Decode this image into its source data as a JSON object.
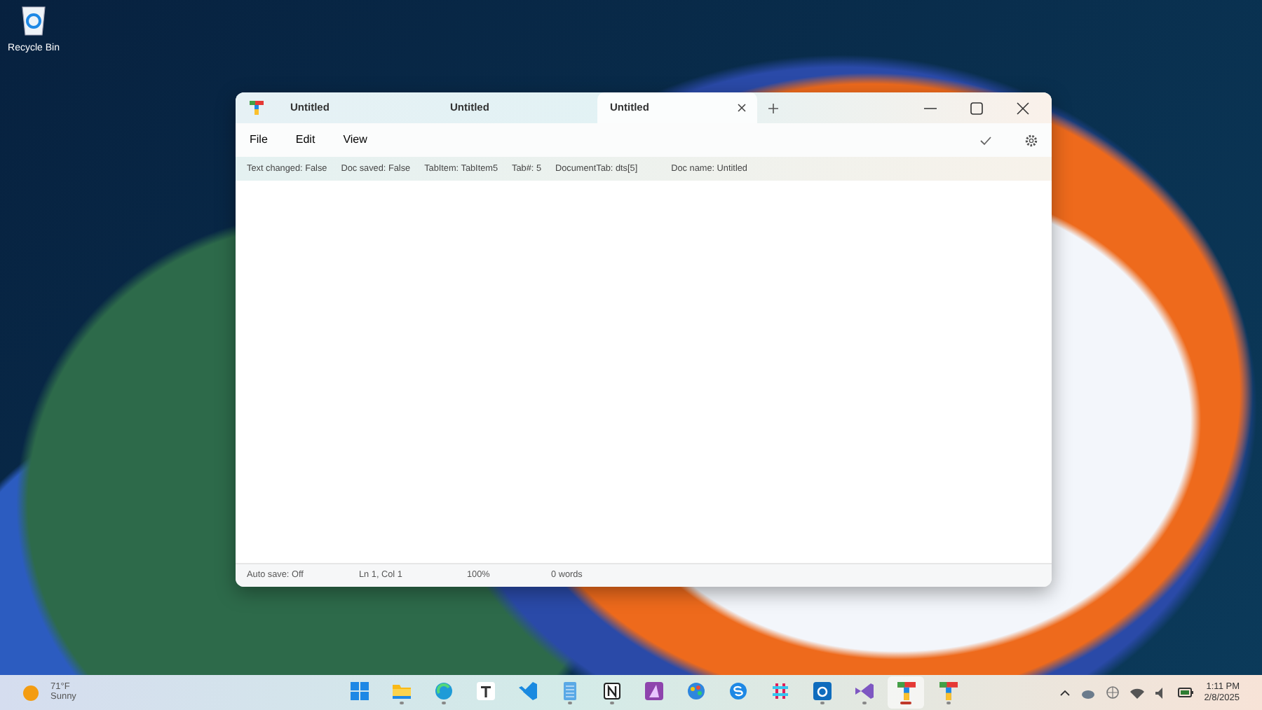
{
  "desktop_icons": [
    {
      "label": "Recycle Bin"
    }
  ],
  "window": {
    "tabs": [
      {
        "title": "Untitled",
        "selected": false
      },
      {
        "title": "Untitled",
        "selected": false
      },
      {
        "title": "Untitled",
        "selected": true
      }
    ],
    "menu": [
      "File",
      "Edit",
      "View"
    ],
    "info_bar": [
      "Text changed: False",
      "Doc saved: False",
      "TabItem: TabItem5",
      "Tab#: 5",
      "DocumentTab: dts[5]",
      "Doc name: Untitled"
    ],
    "status_bar": [
      "Auto save: Off",
      "Ln 1, Col 1",
      "100%",
      "0 words"
    ]
  },
  "taskbar": {
    "weather": {
      "temperature": "71°F",
      "condition": "Sunny"
    },
    "apps": [
      {
        "kind": "start",
        "running": false,
        "selected": false
      },
      {
        "kind": "folder",
        "running": true,
        "selected": false
      },
      {
        "kind": "browser",
        "running": true,
        "selected": false
      },
      {
        "kind": "letter",
        "running": false,
        "selected": false
      },
      {
        "kind": "code",
        "running": false,
        "selected": false
      },
      {
        "kind": "notepad",
        "running": true,
        "selected": false
      },
      {
        "kind": "notion",
        "running": true,
        "selected": false
      },
      {
        "kind": "designer",
        "running": false,
        "selected": false
      },
      {
        "kind": "paint",
        "running": false,
        "selected": false
      },
      {
        "kind": "chat",
        "running": false,
        "selected": false
      },
      {
        "kind": "slack",
        "running": false,
        "selected": false
      },
      {
        "kind": "mail",
        "running": true,
        "selected": false
      },
      {
        "kind": "studio",
        "running": true,
        "selected": false
      },
      {
        "kind": "tlogo",
        "running": true,
        "selected": true
      },
      {
        "kind": "tlogo",
        "running": true,
        "selected": false
      }
    ],
    "clock": {
      "time": "1:11 PM",
      "date": "2/8/2025"
    }
  }
}
